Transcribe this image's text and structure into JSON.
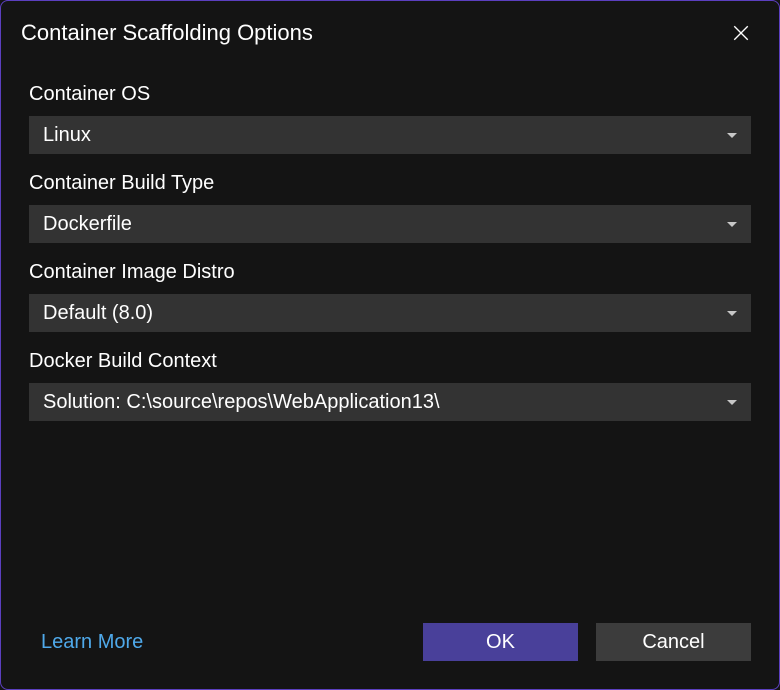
{
  "title": "Container Scaffolding Options",
  "fields": {
    "container_os": {
      "label": "Container OS",
      "value": "Linux"
    },
    "build_type": {
      "label": "Container Build Type",
      "value": "Dockerfile"
    },
    "image_distro": {
      "label": "Container Image Distro",
      "value": "Default (8.0)"
    },
    "build_context": {
      "label": "Docker Build Context",
      "value": "Solution: C:\\source\\repos\\WebApplication13\\"
    }
  },
  "footer": {
    "learn_more": "Learn More",
    "ok": "OK",
    "cancel": "Cancel"
  }
}
